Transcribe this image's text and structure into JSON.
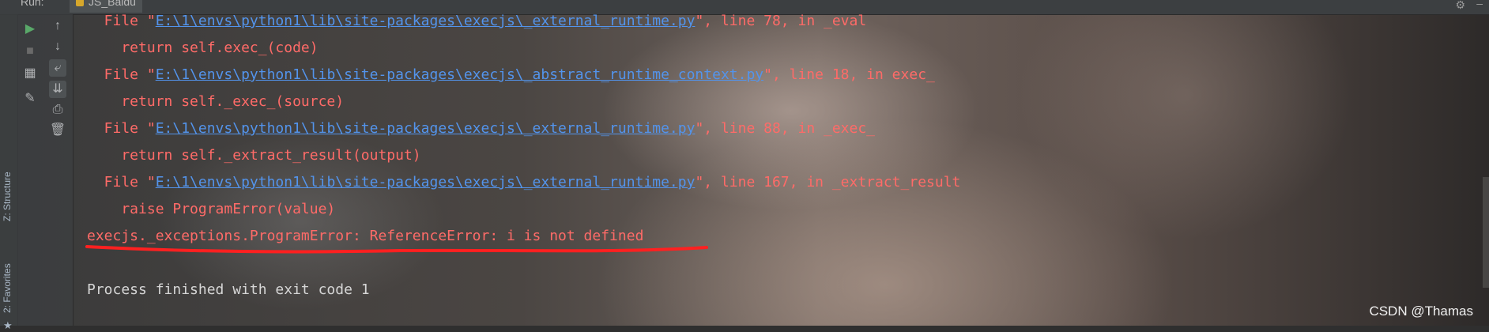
{
  "topbar": {
    "run_label": "Run:",
    "tab_label": "JS_Baidu"
  },
  "side": {
    "structure_label": "Z: Structure",
    "favorites_label": "2: Favorites"
  },
  "console": {
    "lines": [
      {
        "type": "file",
        "prefix": "  File \"",
        "link": "E:\\1\\envs\\python1\\lib\\site-packages\\execjs\\_external_runtime.py",
        "suffix": "\", line 78, in _eval"
      },
      {
        "type": "code",
        "text": "    return self.exec_(code)"
      },
      {
        "type": "file",
        "prefix": "  File \"",
        "link": "E:\\1\\envs\\python1\\lib\\site-packages\\execjs\\_abstract_runtime_context.py",
        "suffix": "\", line 18, in exec_"
      },
      {
        "type": "code",
        "text": "    return self._exec_(source)"
      },
      {
        "type": "file",
        "prefix": "  File \"",
        "link": "E:\\1\\envs\\python1\\lib\\site-packages\\execjs\\_external_runtime.py",
        "suffix": "\", line 88, in _exec_"
      },
      {
        "type": "code",
        "text": "    return self._extract_result(output)"
      },
      {
        "type": "file",
        "prefix": "  File \"",
        "link": "E:\\1\\envs\\python1\\lib\\site-packages\\execjs\\_external_runtime.py",
        "suffix": "\", line 167, in _extract_result"
      },
      {
        "type": "code",
        "text": "    raise ProgramError(value)"
      },
      {
        "type": "error",
        "text": "execjs._exceptions.ProgramError: ReferenceError: i is not defined"
      },
      {
        "type": "blank",
        "text": ""
      },
      {
        "type": "normal",
        "text": "Process finished with exit code 1"
      }
    ]
  },
  "watermark": "CSDN @Thamas",
  "colors": {
    "error": "#ff6b68",
    "link": "#5394ec",
    "normal": "#d6d6d6",
    "underline_annotation": "#ff2020"
  }
}
